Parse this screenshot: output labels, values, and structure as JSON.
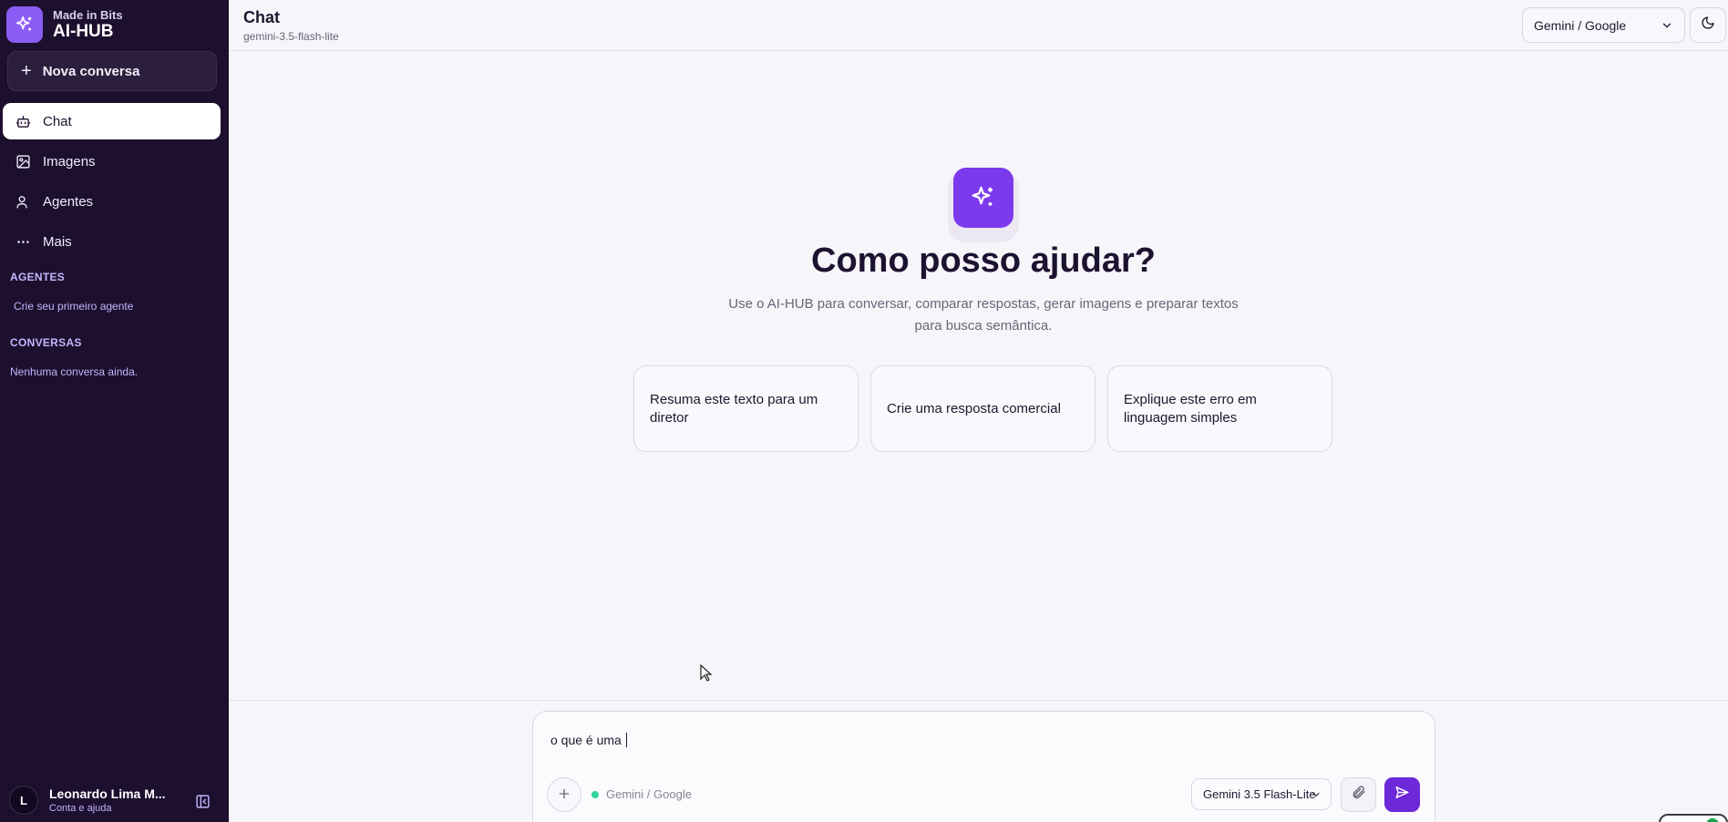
{
  "sidebar": {
    "brand_sub": "Made in Bits",
    "brand_title": "AI-HUB",
    "new_chat_label": "Nova conversa",
    "nav": [
      {
        "label": "Chat",
        "icon": "bot-icon",
        "active": true
      },
      {
        "label": "Imagens",
        "icon": "image-icon",
        "active": false
      },
      {
        "label": "Agentes",
        "icon": "user-icon",
        "active": false
      },
      {
        "label": "Mais",
        "icon": "more-icon",
        "active": false
      }
    ],
    "agents_title": "AGENTES",
    "agents_link": "Crie seu primeiro agente",
    "conversations_title": "CONVERSAS",
    "conversations_empty": "Nenhuma conversa ainda.",
    "user": {
      "initial": "L",
      "name": "Leonardo Lima M...",
      "subtitle": "Conta e ajuda"
    }
  },
  "header": {
    "title": "Chat",
    "subtitle": "gemini-3.5-flash-lite",
    "provider_select": "Gemini / Google"
  },
  "hero": {
    "title": "Como posso ajudar?",
    "description": "Use o AI-HUB para conversar, comparar respostas, gerar imagens e preparar textos para busca semântica."
  },
  "suggestions": [
    "Resuma este texto para um diretor",
    "Crie uma resposta comercial",
    "Explique este erro em linguagem simples"
  ],
  "composer": {
    "value": "o que é uma ",
    "provider": "Gemini / Google",
    "model": "Gemini 3.5 Flash-Lite"
  },
  "colors": {
    "sidebar_bg": "#1d0f2e",
    "accent": "#7c3aed",
    "send_button": "#6d28d9",
    "status_dot": "#34d399",
    "page_bg": "#f6f5fa"
  }
}
